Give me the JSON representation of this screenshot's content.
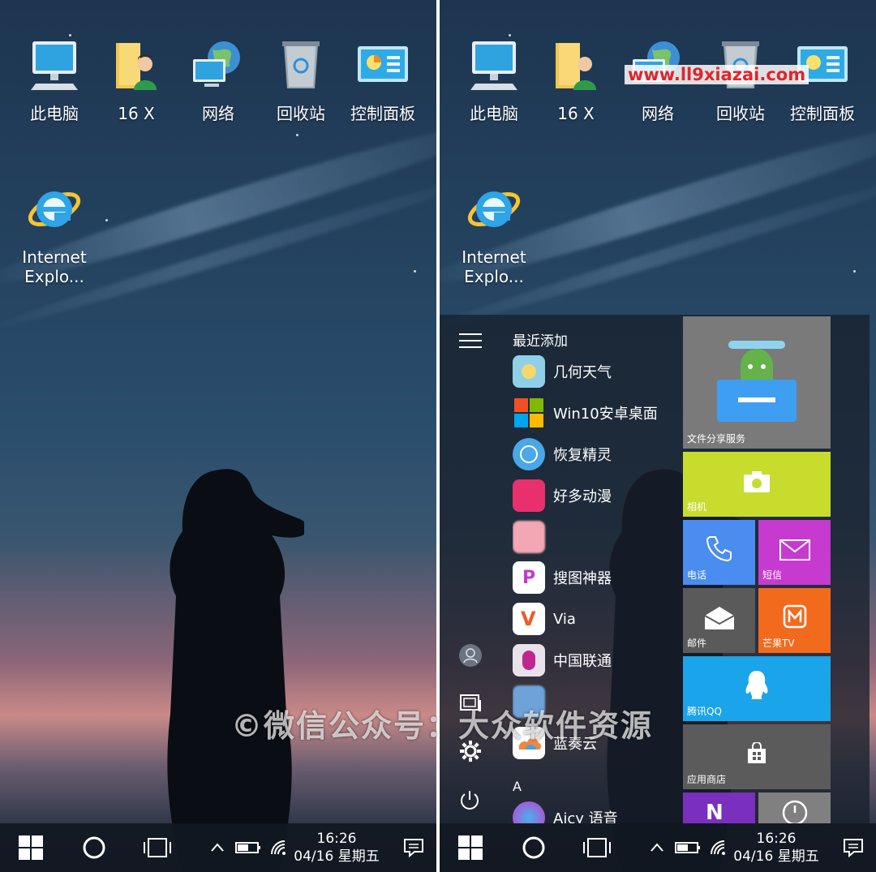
{
  "watermarks": {
    "site": "www.ll9xiazai.com",
    "wechat": "©微信公众号：大众软件资源"
  },
  "desktop_icons": [
    {
      "label": "此电脑",
      "icon": "this-pc-icon"
    },
    {
      "label": "16 X",
      "icon": "user-folder-icon"
    },
    {
      "label": "网络",
      "icon": "network-icon"
    },
    {
      "label": "回收站",
      "icon": "recycle-bin-icon"
    },
    {
      "label": "控制面板",
      "icon": "control-panel-icon"
    },
    {
      "label": "Internet Explo...",
      "icon": "internet-explorer-icon"
    }
  ],
  "taskbar": {
    "time": "16:26",
    "date": "04/16 星期五"
  },
  "start_menu": {
    "section_recent": "最近添加",
    "apps": [
      {
        "label": "几何天气",
        "color": "#8fd0e8"
      },
      {
        "label": "Win10安卓桌面",
        "color": "#ffffff"
      },
      {
        "label": "恢复精灵",
        "color": "#4aa7e8"
      },
      {
        "label": "好多动漫",
        "color": "#e8306e"
      },
      {
        "label": "",
        "color": "#f3a7b5"
      },
      {
        "label": "搜图神器",
        "color": "#ffffff"
      },
      {
        "label": "Via",
        "color": "#ffffff"
      },
      {
        "label": "中国联通",
        "color": "#e8e2ea"
      },
      {
        "label": "",
        "color": "#6fa2d8"
      },
      {
        "label": "蓝奏云",
        "color": "#ffffff"
      }
    ],
    "section_a": "A",
    "app_partial": "Aicy 语音",
    "tiles": [
      {
        "label": "文件分享服务",
        "color": "#7a7a7a"
      },
      {
        "label": "相机",
        "color": "#c8dc2e"
      },
      {
        "label": "电话",
        "color": "#4a8cf0"
      },
      {
        "label": "短信",
        "color": "#c73acf"
      },
      {
        "label": "邮件",
        "color": "#5a5a5a"
      },
      {
        "label": "芒果TV",
        "color": "#f26b1d"
      },
      {
        "label": "腾讯QQ",
        "color": "#1aa4ea"
      },
      {
        "label": "应用商店",
        "color": "#5b5b5b"
      },
      {
        "label": "",
        "color": "#7b2fbe"
      },
      {
        "label": "",
        "color": "#808080"
      }
    ]
  }
}
